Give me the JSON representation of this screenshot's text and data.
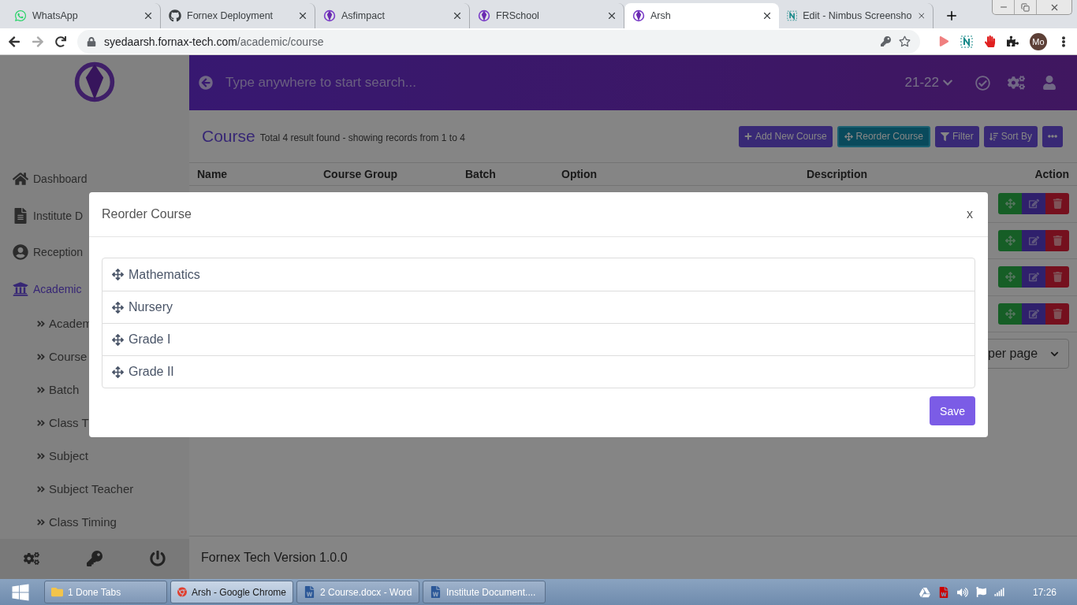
{
  "browser": {
    "tabs": [
      {
        "title": "WhatsApp",
        "kind": "whatsapp",
        "selected": false
      },
      {
        "title": "Fornex Deployment",
        "kind": "github",
        "selected": false
      },
      {
        "title": "Asfimpact",
        "kind": "logo",
        "selected": false
      },
      {
        "title": "FRSchool",
        "kind": "logo",
        "selected": false
      },
      {
        "title": "Arsh",
        "kind": "logo",
        "selected": true
      },
      {
        "title": "Edit - Nimbus Screensho",
        "kind": "nimbus",
        "selected": false
      }
    ],
    "address": {
      "domain": "syedaarsh.fornax-tech.com",
      "path": "/academic/course"
    },
    "profile": "Mo"
  },
  "sidebar": {
    "items": [
      {
        "label": "Dashboard",
        "kind": "home",
        "selected": false
      },
      {
        "label": "Institute D",
        "kind": "file",
        "selected": false
      },
      {
        "label": "Reception",
        "kind": "user",
        "selected": false
      },
      {
        "label": "Academic",
        "kind": "school",
        "selected": true
      }
    ],
    "sub_items": [
      {
        "label": "Academ"
      },
      {
        "label": "Course"
      },
      {
        "label": "Batch"
      },
      {
        "label": "Class T"
      },
      {
        "label": "Subject"
      },
      {
        "label": "Subject Teacher"
      },
      {
        "label": "Class Timing"
      }
    ]
  },
  "header": {
    "search": {
      "placeholder": "Type anywhere to start search..."
    },
    "session": "21-22"
  },
  "page": {
    "title": "Course",
    "summary": "Total 4 result found - showing records from 1 to 4",
    "toolbar": [
      {
        "label": "Add New Course",
        "kind": "add"
      },
      {
        "label": "Reorder Course",
        "kind": "reorder"
      },
      {
        "label": "Filter",
        "kind": "filter"
      },
      {
        "label": "Sort By",
        "kind": "sort"
      },
      {
        "kind": "more"
      }
    ],
    "table": {
      "columns": [
        "Name",
        "Course Group",
        "Batch",
        "Option",
        "Description",
        "Action"
      ]
    },
    "per_page": "per page",
    "footer": "Fornex Tech Version 1.0.0"
  },
  "modal": {
    "title": "Reorder Course",
    "close": "x",
    "items": [
      {
        "label": "Mathematics"
      },
      {
        "label": "Nursery"
      },
      {
        "label": "Grade I"
      },
      {
        "label": "Grade II"
      }
    ],
    "save": "Save"
  },
  "taskbar": {
    "buttons": [
      {
        "label": "1 Done Tabs",
        "kind": "folder",
        "selected": false
      },
      {
        "label": "Arsh - Google Chrome",
        "kind": "chrome",
        "selected": true
      },
      {
        "label": "2 Course.docx - Word",
        "kind": "word",
        "selected": false
      },
      {
        "label": "Institute Document....",
        "kind": "word",
        "selected": false
      }
    ],
    "clock": "17:26"
  }
}
